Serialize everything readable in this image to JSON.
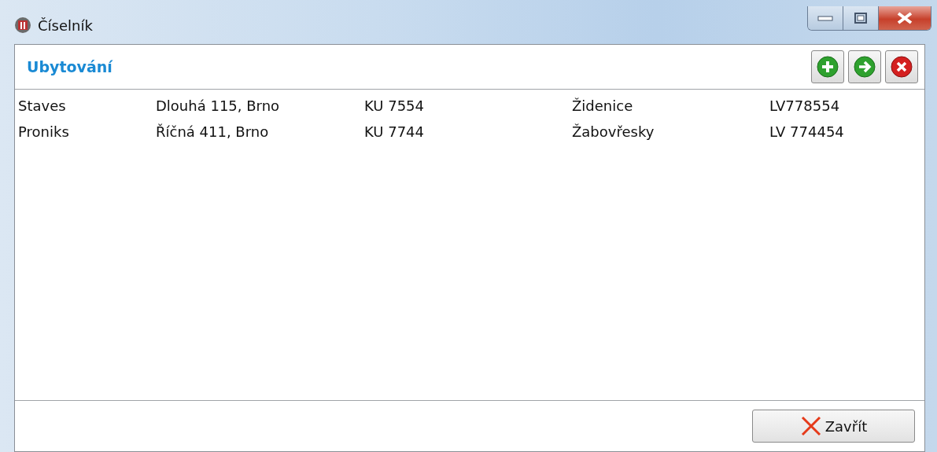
{
  "window": {
    "title": "Číselník"
  },
  "header": {
    "title": "Ubytování"
  },
  "rows": [
    {
      "cells": [
        "Staves",
        "Dlouhá 115, Brno",
        "KU 7554",
        "Židenice",
        "LV778554"
      ]
    },
    {
      "cells": [
        "Proniks",
        "Říčná 411, Brno",
        "KU 7744",
        "Žabovřesky",
        "LV 774454"
      ]
    }
  ],
  "close_button": {
    "label": "Zavřít"
  }
}
